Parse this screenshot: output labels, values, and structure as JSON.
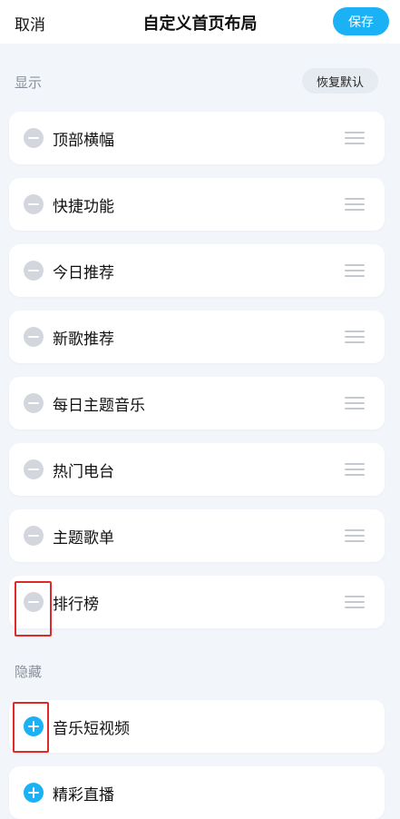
{
  "header": {
    "cancel_label": "取消",
    "title": "自定义首页布局",
    "save_label": "保存"
  },
  "sections": {
    "shown": {
      "label": "显示",
      "restore_label": "恢复默认",
      "items": [
        {
          "label": "顶部横幅"
        },
        {
          "label": "快捷功能"
        },
        {
          "label": "今日推荐"
        },
        {
          "label": "新歌推荐"
        },
        {
          "label": "每日主题音乐"
        },
        {
          "label": "热门电台"
        },
        {
          "label": "主题歌单"
        },
        {
          "label": "排行榜"
        }
      ]
    },
    "hidden": {
      "label": "隐藏",
      "items": [
        {
          "label": "音乐短视频"
        },
        {
          "label": "精彩直播"
        }
      ]
    }
  },
  "colors": {
    "accent": "#1ab1f5",
    "remove_icon": "#d3d7dd",
    "highlight": "#e02a2a",
    "background": "#f2f5fa"
  },
  "icons": {
    "remove": "minus-circle-icon",
    "add": "plus-circle-icon",
    "reorder": "drag-handle-icon"
  }
}
